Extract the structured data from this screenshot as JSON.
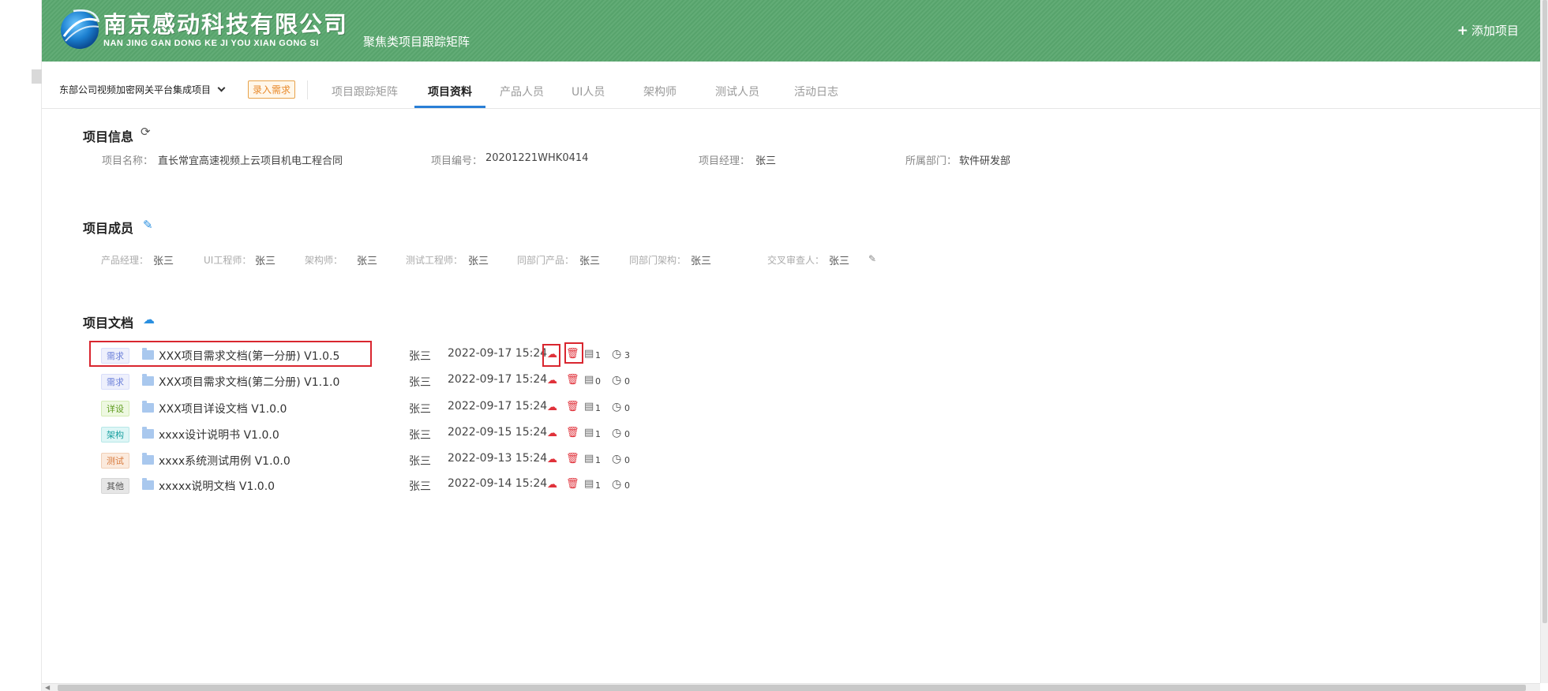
{
  "header": {
    "company_cn": "南京感动科技有限公司",
    "company_en": "NAN JING GAN DONG KE JI YOU XIAN GONG SI",
    "subtitle": "聚焦类项目跟踪矩阵",
    "add_project": "添加项目",
    "add_icon": "plus-icon",
    "logo_icon": "globe-logo"
  },
  "toolbar": {
    "project_selected": "东部公司视频加密网关平台集成项目",
    "enter_requirement": "录入需求",
    "tabs": [
      {
        "label": "项目跟踪矩阵",
        "active": false
      },
      {
        "label": "项目资料",
        "active": true
      },
      {
        "label": "产品人员",
        "active": false
      },
      {
        "label": "UI人员",
        "active": false
      },
      {
        "label": "架构师",
        "active": false
      },
      {
        "label": "测试人员",
        "active": false
      },
      {
        "label": "活动日志",
        "active": false
      }
    ]
  },
  "project_info": {
    "title": "项目信息",
    "fields": [
      {
        "label": "项目名称：",
        "value": "直长常宜高速视频上云项目机电工程合同"
      },
      {
        "label": "项目编号：",
        "value": "20201221WHK0414"
      },
      {
        "label": "项目经理：",
        "value": "张三"
      },
      {
        "label": "所属部门：",
        "value": "软件研发部"
      }
    ]
  },
  "project_members": {
    "title": "项目成员",
    "members": [
      {
        "label": "产品经理：",
        "value": "张三"
      },
      {
        "label": "UI工程师：",
        "value": "张三"
      },
      {
        "label": "架构师：",
        "value": "张三"
      },
      {
        "label": "测试工程师：",
        "value": "张三"
      },
      {
        "label": "同部门产品：",
        "value": "张三"
      },
      {
        "label": "同部门架构：",
        "value": "张三"
      },
      {
        "label": "交叉审查人：",
        "value": "张三"
      }
    ]
  },
  "project_docs": {
    "title": "项目文档",
    "rows": [
      {
        "tag": "需求",
        "name": "XXX项目需求文档(第一分册) V1.0.5",
        "owner": "张三",
        "time": "2022-09-17 15:24",
        "versions": "1",
        "history": "3"
      },
      {
        "tag": "需求",
        "name": "XXX项目需求文档(第二分册) V1.1.0",
        "owner": "张三",
        "time": "2022-09-17 15:24",
        "versions": "0",
        "history": "0"
      },
      {
        "tag": "详设",
        "name": "XXX项目详设文档 V1.0.0",
        "owner": "张三",
        "time": "2022-09-17 15:24",
        "versions": "1",
        "history": "0"
      },
      {
        "tag": "架构",
        "name": "xxxx设计说明书 V1.0.0",
        "owner": "张三",
        "time": "2022-09-15 15:24",
        "versions": "1",
        "history": "0"
      },
      {
        "tag": "测试",
        "name": "xxxx系统测试用例 V1.0.0",
        "owner": "张三",
        "time": "2022-09-13 15:24",
        "versions": "1",
        "history": "0"
      },
      {
        "tag": "其他",
        "name": "xxxxx说明文档 V1.0.0",
        "owner": "张三",
        "time": "2022-09-14 15:24",
        "versions": "1",
        "history": "0"
      }
    ]
  },
  "colors": {
    "header_green": "#5aa86f",
    "active_tab_blue": "#2a7fd6",
    "danger_red": "#e0313a",
    "highlight_red": "#d9262f"
  }
}
